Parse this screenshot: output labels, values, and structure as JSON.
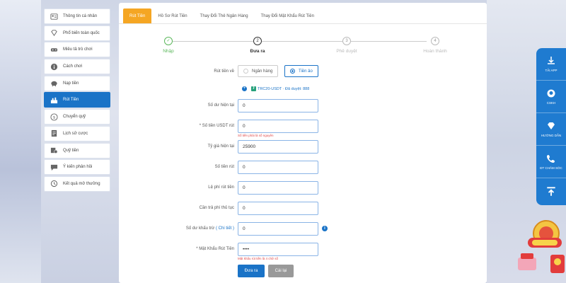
{
  "sidebar": {
    "items": [
      {
        "label": "Thông tin cá nhân",
        "icon": "id-card-icon",
        "active": false
      },
      {
        "label": "Phổ biến toàn quốc",
        "icon": "diamond-icon",
        "active": false
      },
      {
        "label": "Miêu tả trò chơi",
        "icon": "gamepad-icon",
        "active": false
      },
      {
        "label": "Cách chơi",
        "icon": "info-icon",
        "active": false
      },
      {
        "label": "Nạp tiền",
        "icon": "piggy-bank-icon",
        "active": false
      },
      {
        "label": "Rút Tiền",
        "icon": "withdraw-icon",
        "active": true
      },
      {
        "label": "Chuyển quỹ",
        "icon": "exchange-icon",
        "active": false
      },
      {
        "label": "Lịch sử cược",
        "icon": "document-icon",
        "active": false
      },
      {
        "label": "Quỹ tiền",
        "icon": "coins-icon",
        "active": false
      },
      {
        "label": "Ý kiến phản hồi",
        "icon": "chat-icon",
        "active": false
      },
      {
        "label": "Kết quả mở thưởng",
        "icon": "history-icon",
        "active": false
      }
    ]
  },
  "tabs": [
    {
      "label": "Rút Tiền",
      "active": true
    },
    {
      "label": "Hồ Sơ Rút Tiền",
      "active": false
    },
    {
      "label": "Thay Đổi Thẻ Ngân Hàng",
      "active": false
    },
    {
      "label": "Thay Đổi Mật Khẩu Rút Tiền",
      "active": false
    }
  ],
  "steps": [
    {
      "num": "✓",
      "label": "Nhập",
      "state": "done"
    },
    {
      "num": "2",
      "label": "Đưa ra",
      "state": "current"
    },
    {
      "num": "3",
      "label": "Phê duyệt",
      "state": "pending"
    },
    {
      "num": "4",
      "label": "Hoàn thành",
      "state": "pending"
    }
  ],
  "form": {
    "withdraw_to_label": "Rút tiền về",
    "option_bank": "Ngân hàng",
    "option_virtual": "Tiền ảo",
    "address_text": "TRC20-USDT · Đã duyệt: 888",
    "balance_label": "Số dư hiện tại",
    "balance_value": "0",
    "usdt_label": "* Số tiền USDT rút",
    "usdt_value": "0",
    "usdt_error": "Số tiền phải là số nguyên",
    "rate_label": "Tỷ giá hiện tại",
    "rate_value": "25900",
    "amount_label": "Số tiền rút",
    "amount_value": "0",
    "fee_label": "Lệ phí rút tiền",
    "fee_value": "0",
    "fee_offset_label": "Cần trả phí thủ tục",
    "fee_offset_value": "0",
    "deduct_label": "Số dư khấu trừ",
    "deduct_link": "( Chi tiết )",
    "deduct_value": "0",
    "password_label": "* Mật Khẩu Rút Tiền",
    "password_value": "••••",
    "password_error": "Mật khẩu rút tiền là 4 chữ số",
    "submit_label": "Đưa ra",
    "cancel_label": "Cài lại"
  },
  "float_menu": [
    {
      "label": "TẢI APP",
      "icon": "download-icon"
    },
    {
      "label": "CSKH",
      "icon": "support-icon"
    },
    {
      "label": "HƯỚNG DẪN",
      "icon": "diamond-guide-icon"
    },
    {
      "label": "ĐT CHĂM SÓC",
      "icon": "phone-icon"
    }
  ],
  "colors": {
    "primary": "#1a73c7",
    "tab_active": "#f5a623",
    "step_done": "#5cb85c",
    "error": "#e04848"
  }
}
